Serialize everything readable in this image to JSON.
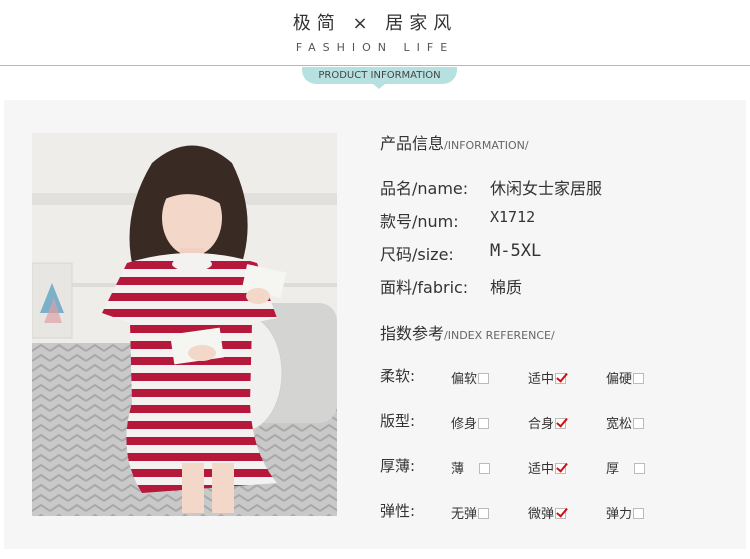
{
  "header": {
    "brand_cn": "极简 × 居家风",
    "brand_en": "FASHION LIFE",
    "badge": "PRODUCT INFORMATION"
  },
  "product_info": {
    "title_cn": "产品信息",
    "title_en": "/INFORMATION/",
    "rows": [
      {
        "label": "品名/name:",
        "value": "休闲女士家居服"
      },
      {
        "label": "款号/num:",
        "value": "X1712"
      },
      {
        "label": "尺码/size:",
        "value": "M-5XL"
      },
      {
        "label": "面料/fabric:",
        "value": "棉质"
      }
    ]
  },
  "index_reference": {
    "title_cn": "指数参考",
    "title_en": "/INDEX REFERENCE/",
    "rows": [
      {
        "label": "柔软:",
        "options": [
          {
            "text": "偏软",
            "checked": false
          },
          {
            "text": "适中",
            "checked": true
          },
          {
            "text": "偏硬",
            "checked": false
          }
        ]
      },
      {
        "label": "版型:",
        "options": [
          {
            "text": "修身",
            "checked": false
          },
          {
            "text": "合身",
            "checked": true
          },
          {
            "text": "宽松",
            "checked": false
          }
        ]
      },
      {
        "label": "厚薄:",
        "options": [
          {
            "text": "薄",
            "checked": false
          },
          {
            "text": "适中",
            "checked": true
          },
          {
            "text": "厚",
            "checked": false
          }
        ]
      },
      {
        "label": "弹性:",
        "options": [
          {
            "text": "无弹",
            "checked": false
          },
          {
            "text": "微弹",
            "checked": true
          },
          {
            "text": "弹力",
            "checked": false
          }
        ]
      }
    ]
  },
  "colors": {
    "badge": "#b7e1e0",
    "check": "#d01010",
    "stripe": "#b5183a"
  },
  "photo": {
    "icon": "model-photo"
  }
}
